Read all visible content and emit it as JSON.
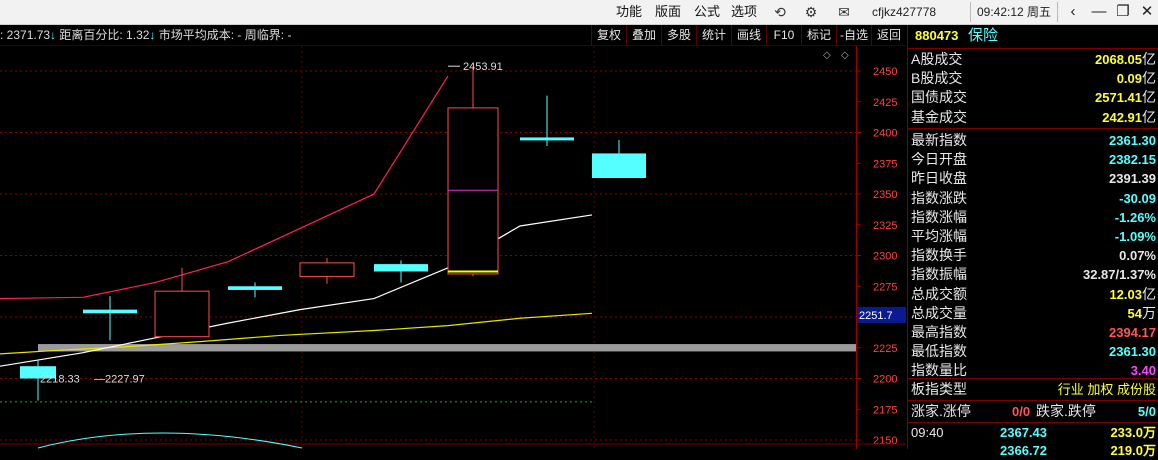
{
  "menu": {
    "items": [
      "功能",
      "版面",
      "公式",
      "选项"
    ]
  },
  "user": "cfjkz427778",
  "clock": "09:42:12 周五",
  "window": {
    "back": "‹",
    "minimize": "—",
    "restore": "❐",
    "close": "✕"
  },
  "info_bar": {
    "prefix": ": 2371.73",
    "arrow1": "↓",
    "distance_label": "距离百分比: 1.32",
    "arrow2": "↓",
    "cost_label": "市场平均成本: -",
    "cycle_label": "周临界: -"
  },
  "toolbar": [
    "复权",
    "叠加",
    "多股",
    "统计",
    "画线",
    "F10",
    "标记",
    "-自选",
    "返回"
  ],
  "panel": {
    "code": "880473",
    "name": "保险",
    "rows1": [
      {
        "label": "A股成交",
        "value": "2068.05",
        "unit": "亿",
        "color": "#ffff33"
      },
      {
        "label": "B股成交",
        "value": "0.09",
        "unit": "亿",
        "color": "#ffff33"
      },
      {
        "label": "国债成交",
        "value": "2571.41",
        "unit": "亿",
        "color": "#ffff33"
      },
      {
        "label": "基金成交",
        "value": "242.91",
        "unit": "亿",
        "color": "#ffff33"
      }
    ],
    "rows2": [
      {
        "label": "最新指数",
        "value": "2361.30",
        "unit": "",
        "color": "#55ffff"
      },
      {
        "label": "今日开盘",
        "value": "2382.15",
        "unit": "",
        "color": "#55ffff"
      },
      {
        "label": "昨日收盘",
        "value": "2391.39",
        "unit": "",
        "color": "#e8e8e8"
      },
      {
        "label": "指数涨跌",
        "value": "-30.09",
        "unit": "",
        "color": "#55ffff"
      },
      {
        "label": "指数涨幅",
        "value": "-1.26%",
        "unit": "",
        "color": "#55ffff"
      },
      {
        "label": "平均涨幅",
        "value": "-1.09%",
        "unit": "",
        "color": "#55ffff"
      },
      {
        "label": "指数换手",
        "value": "0.07%",
        "unit": "",
        "color": "#e8e8e8"
      },
      {
        "label": "指数振幅",
        "value": "32.87/1.37%",
        "unit": "",
        "color": "#e8e8e8"
      },
      {
        "label": "总成交额",
        "value": "12.03",
        "unit": "亿",
        "color": "#ffff33"
      },
      {
        "label": "总成交量",
        "value": "54",
        "unit": "万",
        "color": "#ffff33"
      },
      {
        "label": "最高指数",
        "value": "2394.17",
        "unit": "",
        "color": "#ff5555"
      },
      {
        "label": "最低指数",
        "value": "2361.30",
        "unit": "",
        "color": "#55ffff"
      },
      {
        "label": "指数量比",
        "value": "3.40",
        "unit": "",
        "color": "#ff44ff"
      }
    ],
    "type_label": "板指类型",
    "type_value": "行业 加权 成份股",
    "updown_label1": "涨家.涨停",
    "updown_value1": "0/0",
    "updown_label2": "跌家.跌停",
    "updown_value2": "5/0",
    "tick": {
      "time": "09:40",
      "price": "2367.43",
      "vol": "233.0万"
    },
    "tick2": {
      "price": "2366.72",
      "vol": "219.0万"
    }
  },
  "chart_data": {
    "type": "candlestick",
    "y_ticks": [
      2450,
      2425,
      2400,
      2375,
      2350,
      2325,
      2300,
      2275,
      2250,
      2225,
      2200,
      2175,
      2150
    ],
    "candles": [
      {
        "open": 2210,
        "close": 2200,
        "high": 2215,
        "low": 2182
      },
      {
        "open": 2256,
        "close": 2253,
        "high": 2267,
        "low": 2231
      },
      {
        "open": 2234,
        "close": 2271,
        "high": 2290,
        "low": 2234
      },
      {
        "open": 2275,
        "close": 2272,
        "high": 2278,
        "low": 2266
      },
      {
        "open": 2283,
        "close": 2294,
        "high": 2298,
        "low": 2277
      },
      {
        "open": 2293,
        "close": 2287,
        "high": 2296,
        "low": 2278
      },
      {
        "open": 2285,
        "close": 2420,
        "high": 2453.91,
        "low": 2283
      },
      {
        "open": 2396,
        "close": 2394,
        "high": 2430,
        "low": 2389
      },
      {
        "open": 2383,
        "close": 2363,
        "high": 2394,
        "low": 2363
      }
    ],
    "ma_white": [
      2210,
      2221,
      2233,
      2245,
      2256,
      2265,
      2290,
      2324,
      2333
    ],
    "ma_red": [
      2265,
      2266,
      2278,
      2295,
      2322,
      2350,
      2446
    ],
    "ma_yellow": [
      2220,
      2223,
      2226,
      2230,
      2235,
      2239,
      2243,
      2249,
      2253
    ],
    "current_price_label": "2251.7",
    "current_price": 2251.7,
    "high_label": "2453.91",
    "low_label": "2218.33",
    "low2_label": "2227.97",
    "support_band": [
      2222,
      2228
    ]
  }
}
